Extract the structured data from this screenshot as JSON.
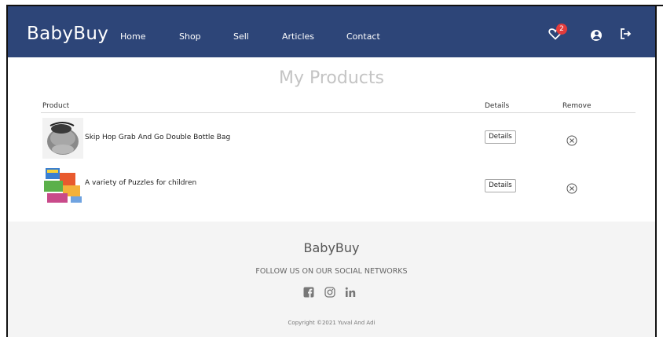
{
  "header": {
    "brand": "BabyBuy",
    "nav": [
      {
        "label": "Home"
      },
      {
        "label": "Shop"
      },
      {
        "label": "Sell"
      },
      {
        "label": "Articles"
      },
      {
        "label": "Contact"
      }
    ],
    "wishlist_count": "2",
    "icons": [
      "heart-icon",
      "user-icon",
      "logout-icon"
    ]
  },
  "main": {
    "title": "My Products",
    "columns": {
      "product": "Product",
      "details": "Details",
      "remove": "Remove"
    },
    "products": [
      {
        "name": "Skip Hop Grab And Go Double Bottle Bag",
        "details_label": "Details"
      },
      {
        "name": "A variety of Puzzles for children",
        "details_label": "Details"
      }
    ]
  },
  "footer": {
    "brand": "BabyBuy",
    "follow": "FOLLOW US ON OUR SOCIAL NETWORKS",
    "social_icons": [
      "facebook-icon",
      "instagram-icon",
      "linkedin-icon"
    ],
    "copyright": "Copyright ©2021 Yuval And Adi"
  },
  "colors": {
    "navbar": "#2d4578",
    "badge": "#e23b3b",
    "footer_bg": "#f4f4f4"
  }
}
